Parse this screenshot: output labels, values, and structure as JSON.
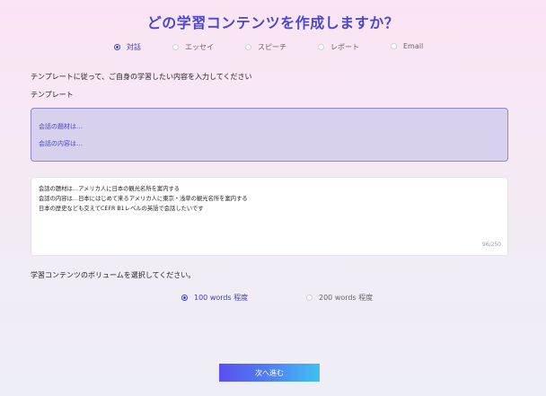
{
  "header": {
    "title": "どの学習コンテンツを作成しますか？"
  },
  "content_types": [
    {
      "label": "対話",
      "selected": true
    },
    {
      "label": "エッセイ",
      "selected": false
    },
    {
      "label": "スピーチ",
      "selected": false
    },
    {
      "label": "レポート",
      "selected": false
    },
    {
      "label": "Email",
      "selected": false
    }
  ],
  "instruction": "テンプレートに従って、ご自身の学習したい内容を入力してください",
  "template": {
    "heading": "テンプレート",
    "lines": [
      "会話の題材は…",
      "会話の内容は…"
    ]
  },
  "input": {
    "lines": [
      "会話の題材は…アメリカ人に日本の観光名所を案内する",
      "会話の内容は…日本にはじめて来るアメリカ人に東京・浅草の観光名所を案内する",
      "日本の歴史なども交えてCEFR B1レベルの英語で会話したいです"
    ],
    "counter": "96/250"
  },
  "volume": {
    "label": "学習コンテンツのボリュームを選択してください。",
    "options": [
      {
        "label": "100 words 程度",
        "selected": true
      },
      {
        "label": "200 words 程度",
        "selected": false
      }
    ]
  },
  "next_button": {
    "label": "次へ進む"
  },
  "colors": {
    "accent": "#4346d8",
    "template_bg": "#d8d1ee",
    "title": "#4a48cc"
  }
}
